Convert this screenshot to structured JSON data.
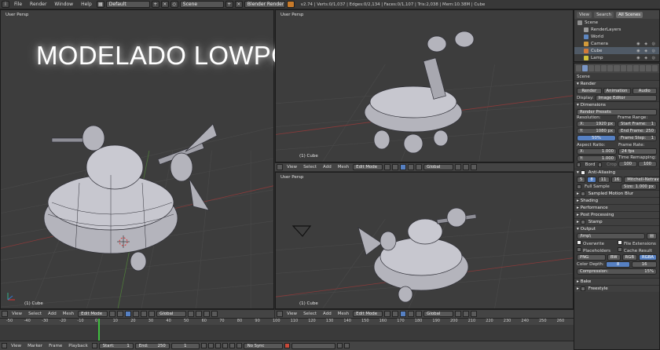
{
  "topbar": {
    "menus": [
      "File",
      "Render",
      "Window",
      "Help"
    ],
    "layout": "Default",
    "scene": "Scene",
    "engine": "Blender Render",
    "stats": "v2.74 | Verts:0/1,037 | Edges:0/2,134 | Faces:0/1,107 | Tris:2,038 | Mem:10.38M | Cube"
  },
  "overlay_title": "MODELADO LOWPOLY",
  "views": {
    "left": {
      "label": "User Persp",
      "obj": "(1) Cube"
    },
    "tr": {
      "label": "User Persp",
      "obj": "(1) Cube"
    },
    "br": {
      "label": "User Persp",
      "obj": "(1) Cube"
    }
  },
  "viewheader": {
    "menus": [
      "View",
      "Select",
      "Add",
      "Mesh"
    ],
    "mode": "Edit Mode",
    "orientation": "Global"
  },
  "outliner": {
    "tabs": [
      "View",
      "Search",
      "All Scenes"
    ],
    "items": [
      {
        "label": "Scene",
        "color": "#8f8f8f"
      },
      {
        "label": "RenderLayers",
        "color": "#9b9b9b"
      },
      {
        "label": "World",
        "color": "#5d86c0"
      },
      {
        "label": "Camera",
        "color": "#d29a3a"
      },
      {
        "label": "Cube",
        "color": "#d27a3a"
      },
      {
        "label": "Lamp",
        "color": "#d2c23a"
      }
    ]
  },
  "props": {
    "scene_label": "Scene",
    "render": {
      "title": "Render",
      "buttons": [
        "Render",
        "Animation",
        "Audio"
      ],
      "display_label": "Display:",
      "display_value": "Image Editor"
    },
    "dimensions": {
      "title": "Dimensions",
      "presets": "Render Presets",
      "resolution": "Resolution:",
      "x": "1920 px",
      "y": "1080 px",
      "pct": "50%",
      "frame_range": "Frame Range:",
      "start": "1",
      "end": "250",
      "step": "1",
      "start_label": "Start Frame:",
      "end_label": "End Frame:",
      "step_label": "Frame Step:",
      "aspect": "Aspect Ratio:",
      "ax": "1.000",
      "ay": "1.000",
      "frame_rate": "Frame Rate:",
      "fps": "24 fps",
      "time_remap": "Time Remapping:",
      "old": "100",
      "new": "100",
      "border": "Bord",
      "crop": "Crop"
    },
    "aa": {
      "title": "Anti-Aliasing",
      "samples": [
        "5",
        "8",
        "11",
        "16"
      ],
      "filter": "Mitchell-Netravali",
      "full_sample": "Full Sample",
      "size_label": "Size:",
      "size": "1.000 px"
    },
    "sections": [
      "Sampled Motion Blur",
      "Shading",
      "Performance",
      "Post Processing",
      "Stamp"
    ],
    "output": {
      "title": "Output",
      "path": "/tmp\\",
      "overwrite": "Overwrite",
      "file_ext": "File Extensions",
      "placeholders": "Placeholders",
      "cache": "Cache Result",
      "format": "PNG",
      "bw": "BW",
      "rgb": "RGB",
      "rgba": "RGBA",
      "depth_label": "Color Depth:",
      "depth8": "8",
      "depth16": "16",
      "comp_label": "Compression:",
      "comp": "15%"
    },
    "sections2": [
      "Bake",
      "Freestyle"
    ]
  },
  "timeline": {
    "ticks": [
      "-50",
      "-40",
      "-30",
      "-20",
      "-10",
      "0",
      "10",
      "20",
      "30",
      "40",
      "50",
      "60",
      "70",
      "80",
      "90",
      "100",
      "110",
      "120",
      "130",
      "140",
      "150",
      "160",
      "170",
      "180",
      "190",
      "200",
      "210",
      "220",
      "230",
      "240",
      "250",
      "260"
    ],
    "menus": [
      "View",
      "Marker",
      "Frame",
      "Playback"
    ],
    "start_label": "Start:",
    "start": "1",
    "end_label": "End:",
    "end": "250",
    "current": "1",
    "sync": "No Sync"
  },
  "colors": {
    "accent": "#5680c2",
    "playhead": "#3fbf3f"
  }
}
